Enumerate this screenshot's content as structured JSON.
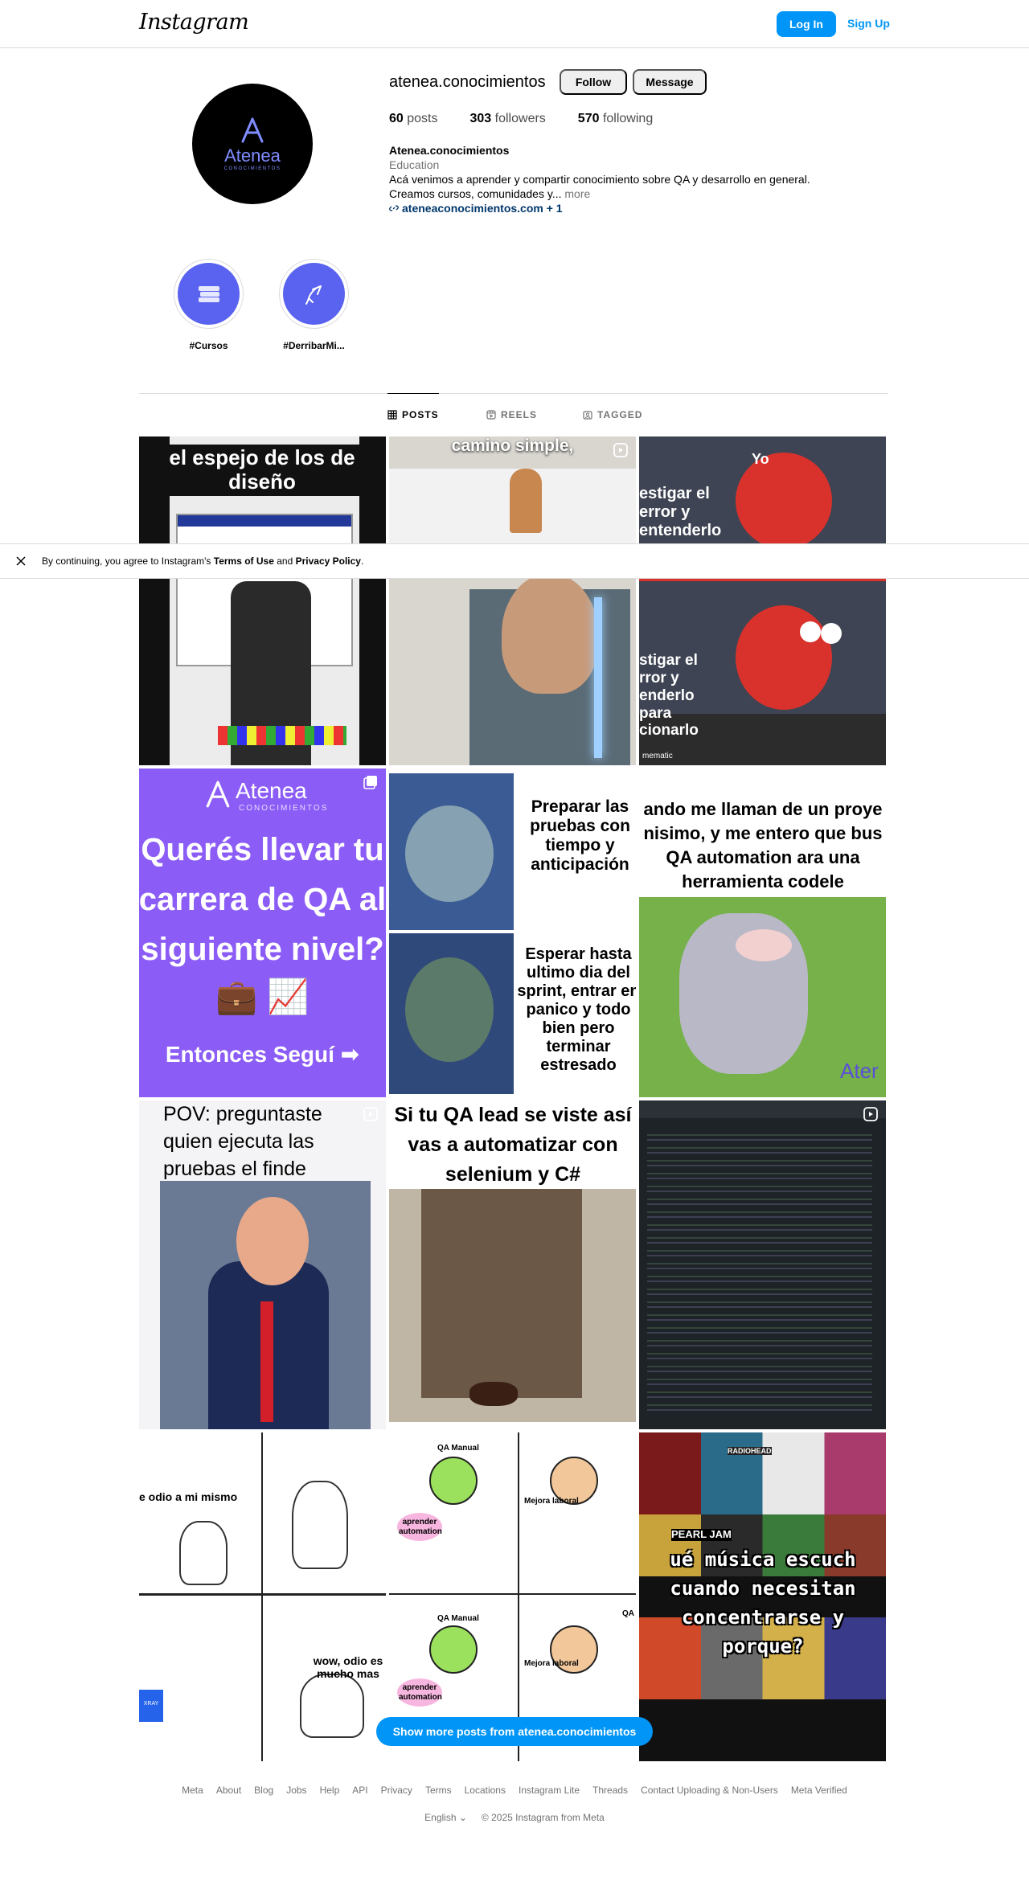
{
  "nav": {
    "logo": "Instagram",
    "login": "Log In",
    "signup": "Sign Up"
  },
  "profile": {
    "avatar_brand": "Atenea",
    "avatar_sub": "CONOCIMIENTOS",
    "username": "atenea.conocimientos",
    "follow": "Follow",
    "message": "Message",
    "stats": {
      "posts_n": "60",
      "posts_lbl": "posts",
      "followers_n": "303",
      "followers_lbl": "followers",
      "following_n": "570",
      "following_lbl": "following"
    },
    "bio": {
      "name": "Atenea.conocimientos",
      "category": "Education",
      "line1": "Acá venimos a aprender y compartir conocimiento sobre QA y desarrollo en general.",
      "line2": "Creamos cursos, comunidades y...",
      "more": "more",
      "link": "ateneaconocimientos.com + 1"
    }
  },
  "highlights": [
    {
      "label": "#Cursos",
      "icon": "books-icon"
    },
    {
      "label": "#DerribarMi...",
      "icon": "rocket-icon"
    }
  ],
  "tabs": [
    {
      "label": "POSTS",
      "icon": "grid-icon",
      "active": true
    },
    {
      "label": "REELS",
      "icon": "reels-icon",
      "active": false
    },
    {
      "label": "TAGGED",
      "icon": "tagged-icon",
      "active": false
    }
  ],
  "posts": {
    "p1_caption": "el espejo de los de diseño",
    "p2_caption": "camino simple,",
    "p3_caption_top": "Yo",
    "p3_caption_left": "estigar el error y entenderlo",
    "p6_caption": "stigar el rror y enderlo para cionarlo",
    "p6_watermark": "mematic",
    "p7_brand": "Atenea",
    "p7_sub": "CONOCIMIENTOS",
    "p7_caption": "Querés llevar tu carrera de QA al siguiente nivel?",
    "p7_emoji": "💼 📈",
    "p7_cta": "Entonces Seguí ➡",
    "p8_top": "Preparar las pruebas con tiempo y anticipación",
    "p8_bottom": "Esperar hasta ultimo dia del sprint, entrar en panico y todo bien pero terminar estresado",
    "p9_caption": "ando me llaman de un proye nisimo, y me entero que bus QA automation ara una herramienta codele",
    "p9_watermark": "Ater",
    "p10_caption": "POV: preguntaste quien ejecuta las pruebas el finde",
    "p11_caption": "Si tu QA lead se viste así vas a automatizar con selenium y C#",
    "p13_top": "e odio a mi mismo",
    "p13_bottom": "wow, odio es mucho mas",
    "p13_badge": "XRAY",
    "p14_qa_manual": "QA Manual",
    "p14_aprender": "aprender automation",
    "p14_mejora": "Mejora laboral",
    "p14_qa": "QA",
    "p15_caption": "ué música escuch cuando necesitan concentrarse y porque?",
    "p15_album": "RADIOHEAD",
    "p15_album2": "PEARL JAM"
  },
  "cookie": {
    "text_pre": "By continuing, you agree to Instagram's ",
    "terms": "Terms of Use",
    "and": " and ",
    "privacy": "Privacy Policy",
    "end": "."
  },
  "show_more": "Show more posts from atenea.conocimientos",
  "footer": {
    "links": [
      "Meta",
      "About",
      "Blog",
      "Jobs",
      "Help",
      "API",
      "Privacy",
      "Terms",
      "Locations",
      "Instagram Lite",
      "Threads",
      "Contact Uploading & Non-Users",
      "Meta Verified"
    ],
    "language": "English",
    "copyright": "© 2025 Instagram from Meta"
  }
}
